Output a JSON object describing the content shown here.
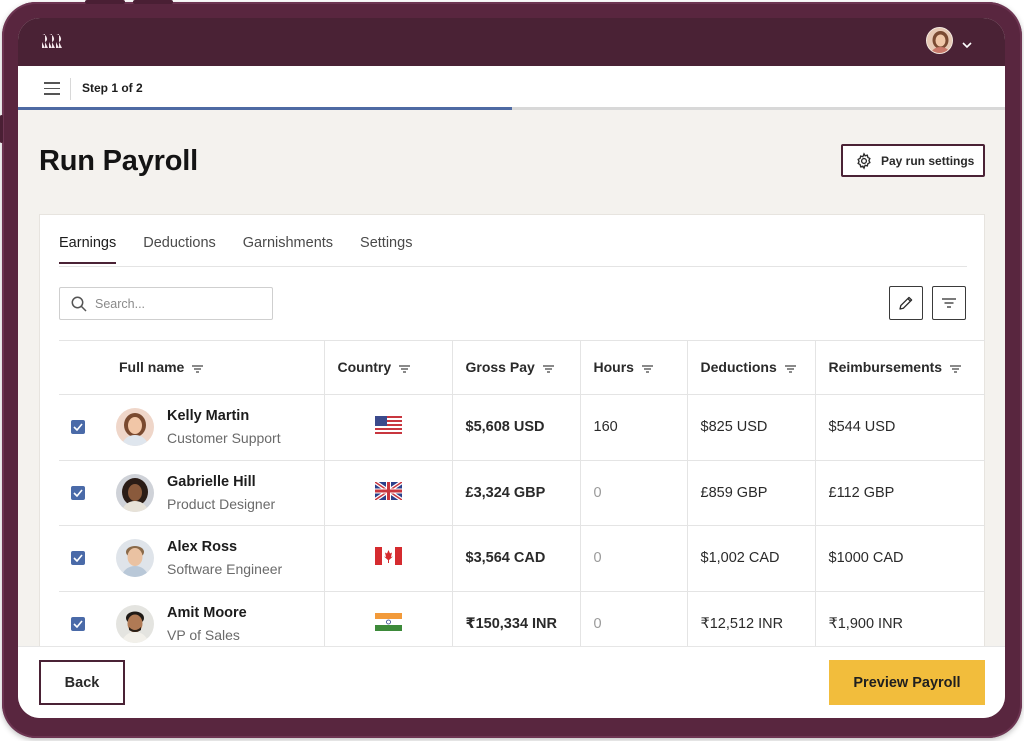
{
  "app": {
    "logo_icon": "brand-logo-icon"
  },
  "step": {
    "label": "Step 1 of 2",
    "progress": 0.5
  },
  "page": {
    "title": "Run Payroll"
  },
  "settings_button": {
    "label": "Pay run settings",
    "icon": "gear-icon"
  },
  "tabs": [
    {
      "label": "Earnings",
      "active": true
    },
    {
      "label": "Deductions",
      "active": false
    },
    {
      "label": "Garnishments",
      "active": false
    },
    {
      "label": "Settings",
      "active": false
    }
  ],
  "search": {
    "placeholder": "Search...",
    "value": ""
  },
  "table": {
    "columns": [
      "Full name",
      "Country",
      "Gross Pay",
      "Hours",
      "Deductions",
      "Reimbursements"
    ],
    "rows": [
      {
        "checked": true,
        "name": "Kelly Martin",
        "role": "Customer Support",
        "country_flag": "us-flag-icon",
        "gross_pay": "$5,608 USD",
        "hours": "160",
        "deductions": "$825 USD",
        "reimbursements": "$544 USD"
      },
      {
        "checked": true,
        "name": "Gabrielle Hill",
        "role": "Product Designer",
        "country_flag": "uk-flag-icon",
        "gross_pay": "£3,324 GBP",
        "hours": "0",
        "deductions": "£859 GBP",
        "reimbursements": "£112 GBP"
      },
      {
        "checked": true,
        "name": "Alex Ross",
        "role": "Software Engineer",
        "country_flag": "canada-flag-icon",
        "gross_pay": "$3,564 CAD",
        "hours": "0",
        "deductions": "$1,002 CAD",
        "reimbursements": "$1000 CAD"
      },
      {
        "checked": true,
        "name": "Amit Moore",
        "role": "VP of Sales",
        "country_flag": "india-flag-icon",
        "gross_pay": "₹150,334 INR",
        "hours": "0",
        "deductions": "₹12,512 INR",
        "reimbursements": "₹1,900 INR"
      }
    ]
  },
  "footer": {
    "back_label": "Back",
    "preview_label": "Preview Payroll"
  },
  "colors": {
    "brand": "#4a2235",
    "frame": "#59263f",
    "accent_blue": "#4e6aa3",
    "cta": "#f2bd3c"
  }
}
